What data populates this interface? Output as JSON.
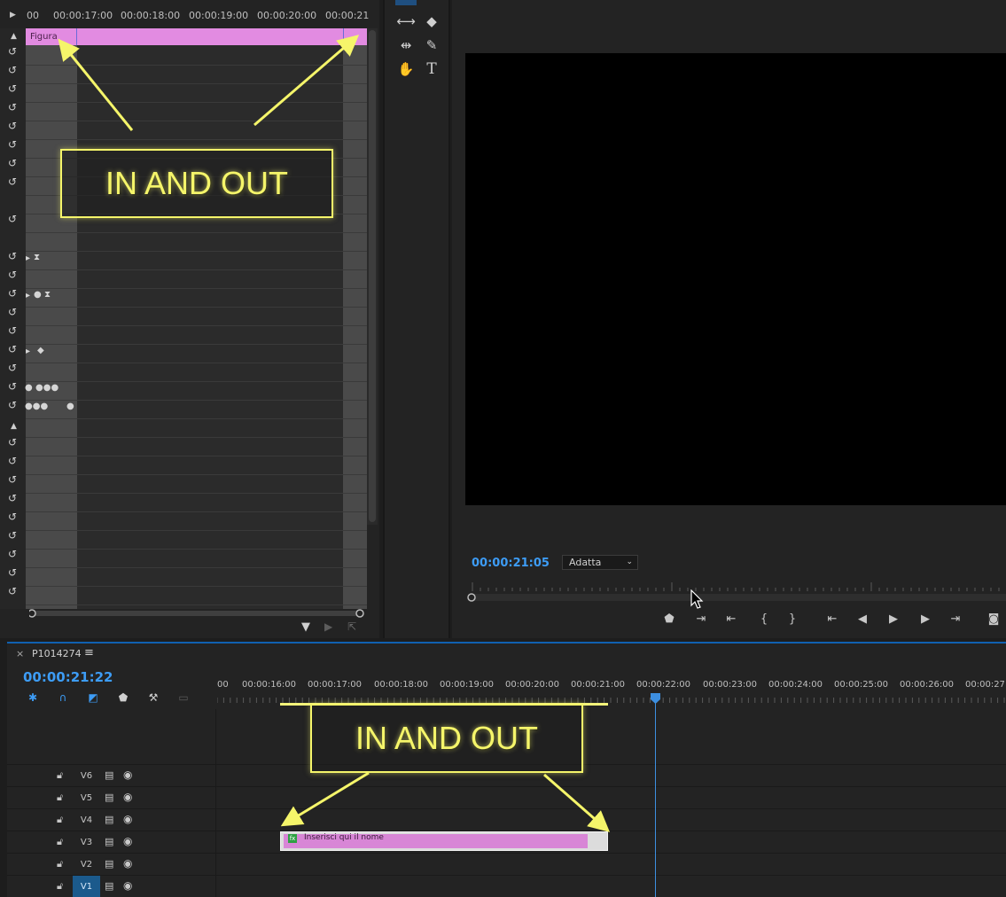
{
  "effect_controls": {
    "ruler_labels": [
      "00",
      "00:00:17:00",
      "00:00:18:00",
      "00:00:19:00",
      "00:00:20:00",
      "00:00:21"
    ],
    "clip_name": "Figura"
  },
  "program_monitor": {
    "timecode": "00:00:21:05",
    "fit_value": "Adatta"
  },
  "timeline": {
    "sequence_name": "P1014274",
    "timecode": "00:00:21:22",
    "ruler_labels": [
      "00",
      "00:00:16:00",
      "00:00:17:00",
      "00:00:18:00",
      "00:00:19:00",
      "00:00:20:00",
      "00:00:21:00",
      "00:00:22:00",
      "00:00:23:00",
      "00:00:24:00",
      "00:00:25:00",
      "00:00:26:00",
      "00:00:27:"
    ],
    "tracks": [
      {
        "name": "V6",
        "active": false
      },
      {
        "name": "V5",
        "active": false
      },
      {
        "name": "V4",
        "active": false
      },
      {
        "name": "V3",
        "active": false
      },
      {
        "name": "V2",
        "active": false
      },
      {
        "name": "V1",
        "active": true
      }
    ],
    "clip": {
      "fx_label": "fx",
      "name": "Inserisci qui il nome"
    }
  },
  "annotations": {
    "effect_controls_callout": "IN AND OUT",
    "timeline_callout": "IN AND OUT",
    "color": "#f5f56a"
  },
  "colors": {
    "clip_pink": "#e28be1",
    "timecode_blue": "#3d9cf5",
    "active_track": "#1b5a8c"
  }
}
